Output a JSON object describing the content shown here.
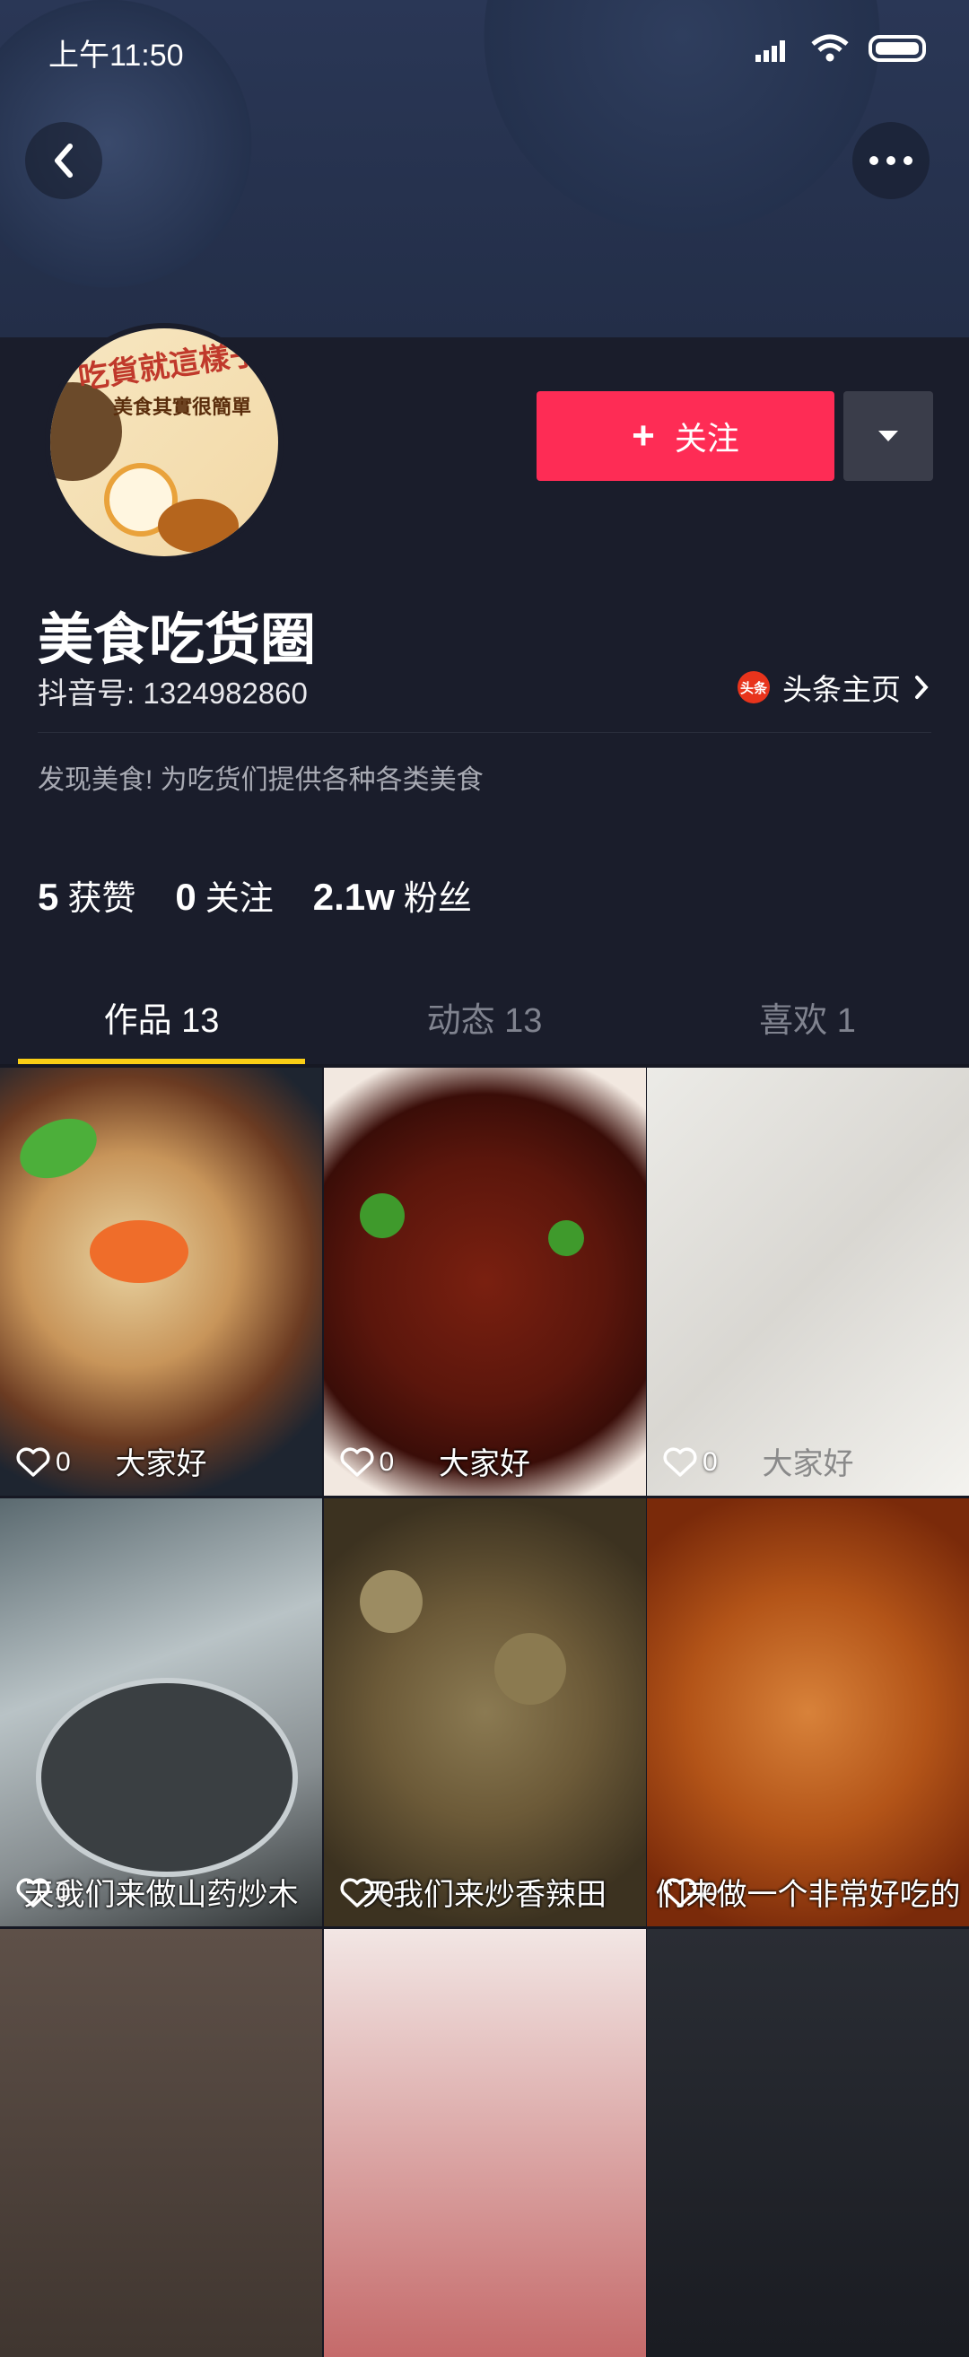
{
  "status_bar": {
    "time": "上午11:50"
  },
  "header": {
    "back": "back",
    "more": "more"
  },
  "profile": {
    "avatar_texts": [
      "吃貨就這樣子",
      "美食其實很簡單"
    ],
    "follow_label": "关注",
    "name": "美食吃货圈",
    "douyin_id": "抖音号: 1324982860",
    "toutiao_badge": "头条",
    "toutiao_label": "头条主页",
    "bio": "发现美食! 为吃货们提供各种各类美食",
    "stats": [
      {
        "value": "5",
        "label": "获赞"
      },
      {
        "value": "0",
        "label": "关注"
      },
      {
        "value": "2.1w",
        "label": "粉丝"
      }
    ]
  },
  "tabs": [
    {
      "label": "作品 13"
    },
    {
      "label": "动态 13"
    },
    {
      "label": "喜欢 1"
    }
  ],
  "videos": [
    {
      "likes": "0",
      "caption": "大家好"
    },
    {
      "likes": "0",
      "caption": "大家好"
    },
    {
      "likes": "0",
      "caption": "大家好"
    },
    {
      "likes": "0",
      "caption": "天我们来做山药炒木"
    },
    {
      "likes": "0",
      "caption": "天我们来炒香辣田"
    },
    {
      "likes": "0",
      "caption": "们来做一个非常好吃的"
    }
  ],
  "colors": {
    "accent": "#fe2c55",
    "tab_indicator": "#face15",
    "background": "#161823"
  }
}
